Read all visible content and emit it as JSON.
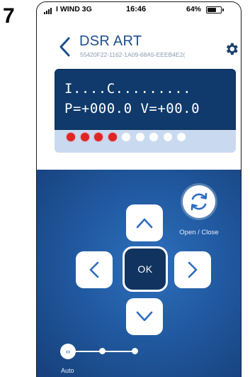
{
  "figure_number": "7",
  "status_bar": {
    "carrier": "I WIND  3G",
    "time": "16:46",
    "battery": "64%",
    "battery_level": 0.64
  },
  "header": {
    "title": "DSR ART",
    "device_id": "55420F22-1162-1A09-68A5-EEEB4E2(",
    "back_icon": "chevron-left-icon",
    "settings_icon": "gear-icon"
  },
  "display": {
    "line1": "I....C.........",
    "line2": "P=+000.0 V=+00.0",
    "leds": [
      "red",
      "red",
      "red",
      "red",
      "white",
      "white",
      "white",
      "white",
      "white"
    ]
  },
  "controls": {
    "ok_label": "OK",
    "open_close_label": "Open / Close",
    "slider_label": "Auto",
    "slider_thumb_symbol": "‹›",
    "slider_position": 0
  },
  "colors": {
    "accent": "#1d4f8c",
    "lcd_background": "#0f3a6b",
    "led_on": "#e02525",
    "control_background": "#215aa1"
  }
}
